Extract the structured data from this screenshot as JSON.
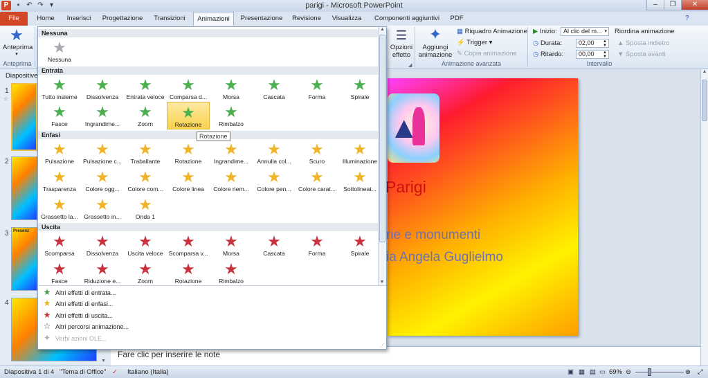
{
  "app": {
    "title": "parigi - Microsoft PowerPoint"
  },
  "tabs": [
    {
      "label": "File"
    },
    {
      "label": "Home"
    },
    {
      "label": "Inserisci"
    },
    {
      "label": "Progettazione"
    },
    {
      "label": "Transizioni"
    },
    {
      "label": "Animazioni"
    },
    {
      "label": "Presentazione"
    },
    {
      "label": "Revisione"
    },
    {
      "label": "Visualizza"
    },
    {
      "label": "Componenti aggiuntivi"
    },
    {
      "label": "PDF"
    }
  ],
  "ribbon": {
    "anteprima": "Anteprima",
    "anteprima_group": "Anteprima",
    "opzioni_effetto_1": "Opzioni",
    "opzioni_effetto_2": "effetto",
    "aggiungi_1": "Aggiungi",
    "aggiungi_2": "animazione",
    "riquadro": "Riquadro Animazione",
    "trigger": "Trigger",
    "copia": "Copia animazione",
    "group_avanzata": "Animazione avanzata",
    "inizio_label": "Inizio:",
    "inizio_value": "Al clic del m...",
    "durata_label": "Durata:",
    "durata_value": "02,00",
    "ritardo_label": "Ritardo:",
    "ritardo_value": "00,00",
    "group_intervallo": "Intervallo",
    "riordina": "Riordina animazione",
    "sposta_indietro": "Sposta indietro",
    "sposta_avanti": "Sposta avanti"
  },
  "leftpane": {
    "tab_label": "Diapositive",
    "thumb_numbers": [
      "1",
      "2",
      "3",
      "4"
    ],
    "thumb3_title": "Presenz"
  },
  "slide": {
    "title": "Parigi",
    "line1": "rie e monumenti",
    "line2": "ia Angela Guglielmo"
  },
  "notes_placeholder": "Fare clic per inserire le note",
  "gallery": {
    "sections": {
      "none": "Nessuna",
      "entrance": "Entrata",
      "emphasis": "Enfasi",
      "exit": "Uscita"
    },
    "none_items": [
      {
        "label": "Nessuna",
        "color": "#a8a8b0"
      }
    ],
    "entrance_items": [
      {
        "label": "Tutto insieme"
      },
      {
        "label": "Dissolvenza"
      },
      {
        "label": "Entrata veloce"
      },
      {
        "label": "Comparsa d..."
      },
      {
        "label": "Morsa"
      },
      {
        "label": "Cascata"
      },
      {
        "label": "Forma"
      },
      {
        "label": "Spirale"
      },
      {
        "label": "Fasce"
      },
      {
        "label": "Ingrandime..."
      },
      {
        "label": "Zoom"
      },
      {
        "label": "Rotazione"
      },
      {
        "label": "Rimbalzo"
      }
    ],
    "emphasis_items": [
      {
        "label": "Pulsazione"
      },
      {
        "label": "Pulsazione c..."
      },
      {
        "label": "Traballante"
      },
      {
        "label": "Rotazione"
      },
      {
        "label": "Ingrandime..."
      },
      {
        "label": "Annulla col..."
      },
      {
        "label": "Scuro"
      },
      {
        "label": "Illuminazione"
      },
      {
        "label": "Trasparenza"
      },
      {
        "label": "Colore ogg..."
      },
      {
        "label": "Colore com..."
      },
      {
        "label": "Colore linea"
      },
      {
        "label": "Colore riem..."
      },
      {
        "label": "Colore pen..."
      },
      {
        "label": "Colore carat..."
      },
      {
        "label": "Sottolineat..."
      },
      {
        "label": "Grassetto la..."
      },
      {
        "label": "Grassetto in..."
      },
      {
        "label": "Onda 1"
      }
    ],
    "exit_items": [
      {
        "label": "Scomparsa"
      },
      {
        "label": "Dissolvenza"
      },
      {
        "label": "Uscita veloce"
      },
      {
        "label": "Scomparsa v..."
      },
      {
        "label": "Morsa"
      },
      {
        "label": "Cascata"
      },
      {
        "label": "Forma"
      },
      {
        "label": "Spirale"
      },
      {
        "label": "Fasce"
      },
      {
        "label": "Riduzione e..."
      },
      {
        "label": "Zoom"
      },
      {
        "label": "Rotazione"
      },
      {
        "label": "Rimbalzo"
      }
    ],
    "selected_entrance_index": 11,
    "tooltip": "Rotazione",
    "more": [
      {
        "label": "Altri effetti di entrata...",
        "color": "#3f9a3f"
      },
      {
        "label": "Altri effetti di enfasi...",
        "color": "#e8b020"
      },
      {
        "label": "Altri effetti di uscita...",
        "color": "#c83030"
      },
      {
        "label": "Altri percorsi animazione...",
        "color": "#555555"
      },
      {
        "label": "Verbi azioni OLE...",
        "color": "#b0b0b0"
      }
    ],
    "colors": {
      "entrance": "#4caf50",
      "emphasis": "#f0b428",
      "exit": "#c8323c"
    }
  },
  "status": {
    "slide": "Diapositiva 1 di 4",
    "theme": "\"Tema di Office\"",
    "lang": "Italiano (Italia)",
    "zoom": "69%"
  }
}
